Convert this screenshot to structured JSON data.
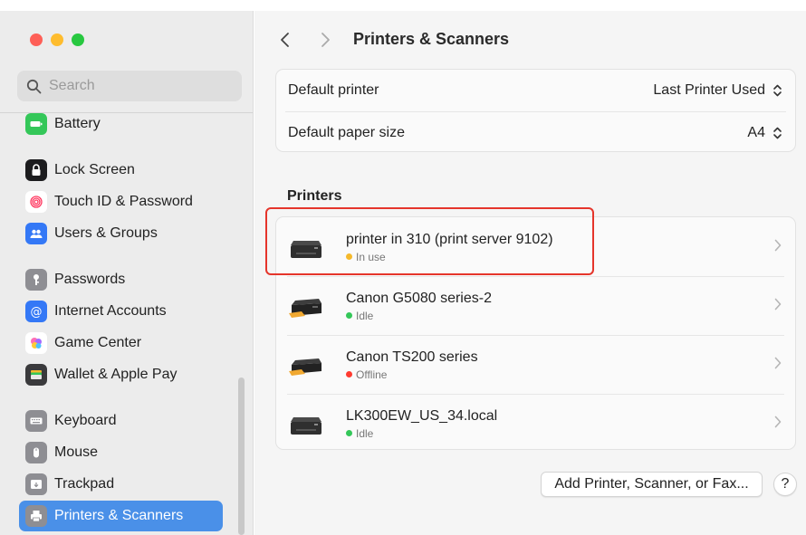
{
  "window": {
    "title": "Printers & Scanners"
  },
  "sidebar": {
    "search": {
      "placeholder": "Search",
      "value": ""
    },
    "items": [
      {
        "label": "Battery",
        "icon": "battery-icon",
        "color": "#34c759"
      },
      {
        "label": "Lock Screen",
        "icon": "lock-icon",
        "color": "#1c1c1e"
      },
      {
        "label": "Touch ID & Password",
        "icon": "fingerprint-icon",
        "color": "#ff375f"
      },
      {
        "label": "Users & Groups",
        "icon": "users-icon",
        "color": "#3478f6"
      },
      {
        "label": "Passwords",
        "icon": "key-icon",
        "color": "#8e8e93"
      },
      {
        "label": "Internet Accounts",
        "icon": "at-icon",
        "color": "#3478f6"
      },
      {
        "label": "Game Center",
        "icon": "game-center-icon",
        "color": "#ffffff"
      },
      {
        "label": "Wallet & Apple Pay",
        "icon": "wallet-icon",
        "color": "#3a3a3c"
      },
      {
        "label": "Keyboard",
        "icon": "keyboard-icon",
        "color": "#8e8e93"
      },
      {
        "label": "Mouse",
        "icon": "mouse-icon",
        "color": "#8e8e93"
      },
      {
        "label": "Trackpad",
        "icon": "trackpad-icon",
        "color": "#8e8e93"
      },
      {
        "label": "Printers & Scanners",
        "icon": "printer-icon",
        "color": "#8e8e93",
        "selected": true
      }
    ]
  },
  "main": {
    "title": "Printers & Scanners",
    "settings": [
      {
        "label": "Default printer",
        "value": "Last Printer Used"
      },
      {
        "label": "Default paper size",
        "value": "A4"
      }
    ],
    "printers_section": "Printers",
    "printers": [
      {
        "name": "printer in 310 (print server 9102)",
        "status": "In use",
        "status_color": "#f5b92c"
      },
      {
        "name": "Canon G5080 series-2",
        "status": "Idle",
        "status_color": "#34c759"
      },
      {
        "name": "Canon TS200 series",
        "status": "Offline",
        "status_color": "#ff3b30"
      },
      {
        "name": "LK300EW_US_34.local",
        "status": "Idle",
        "status_color": "#34c759"
      }
    ],
    "add_button": "Add Printer, Scanner, or Fax...",
    "help_button": "?"
  },
  "colors": {
    "accent": "#4a90e8",
    "highlight": "#e5352b"
  }
}
